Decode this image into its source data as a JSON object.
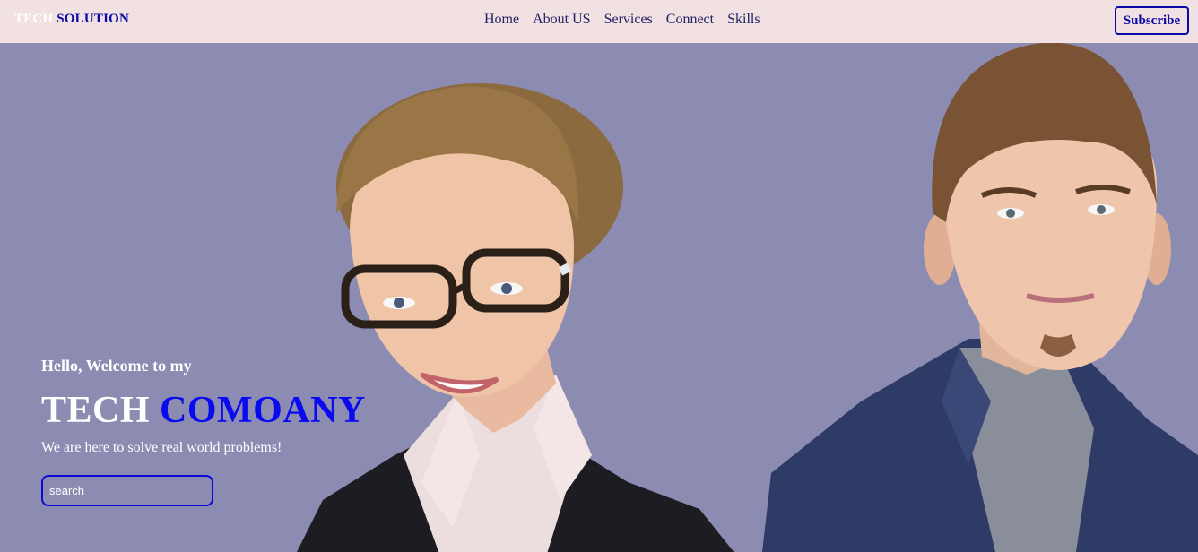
{
  "brand": {
    "part1": "TECH",
    "part2": "SOLUTION"
  },
  "nav": {
    "items": [
      "Home",
      "About US",
      "Services",
      "Connect",
      "Skills"
    ]
  },
  "header": {
    "subscribe_label": "Subscribe"
  },
  "hero": {
    "greeting": "Hello, Welcome to my",
    "headline_part1": "TECH",
    "headline_part2": "COMOANY",
    "tagline": "We are here to solve real world problems!",
    "search_placeholder": "search"
  },
  "colors": {
    "navbar_bg": "#f1e1e2",
    "hero_bg": "#8c8cb2",
    "accent_blue": "#0a0af0",
    "text_white": "#ffffff"
  }
}
